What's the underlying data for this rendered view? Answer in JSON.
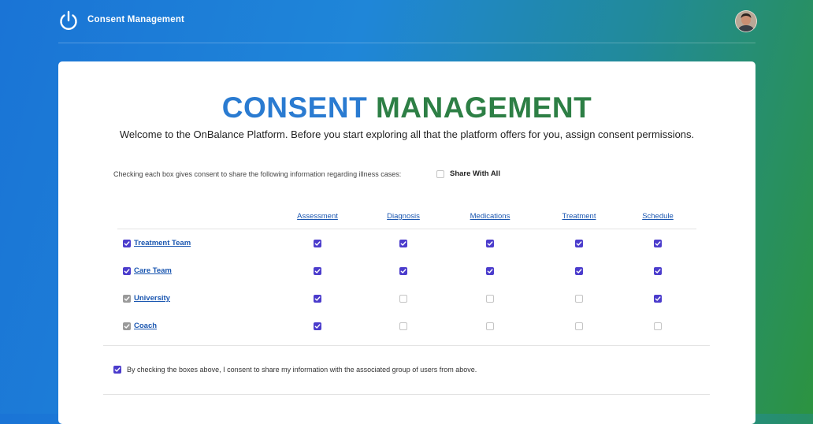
{
  "header": {
    "app_title": "Consent Management",
    "icon": "power-icon",
    "avatar": "user-avatar"
  },
  "main": {
    "title_part1": "CONSENT",
    "title_part2": "MANAGEMENT",
    "welcome": "Welcome to the OnBalance Platform. Before you start exploring all that the platform offers for you, assign consent permissions.",
    "hint": "Checking each box gives consent to share the following information regarding illness cases:",
    "share_all_label": "Share With All",
    "share_all_checked": false,
    "columns": [
      "Assessment",
      "Diagnosis",
      "Medications",
      "Treatment",
      "Schedule"
    ],
    "rows": [
      {
        "label": "Treatment Team",
        "checked": true,
        "disabled_style": false,
        "cells": [
          true,
          true,
          true,
          true,
          true
        ]
      },
      {
        "label": "Care Team",
        "checked": true,
        "disabled_style": false,
        "cells": [
          true,
          true,
          true,
          true,
          true
        ]
      },
      {
        "label": "University",
        "checked": true,
        "disabled_style": true,
        "cells": [
          true,
          false,
          false,
          false,
          true
        ]
      },
      {
        "label": "Coach",
        "checked": true,
        "disabled_style": true,
        "cells": [
          true,
          false,
          false,
          false,
          false
        ]
      }
    ],
    "agree_text": "By checking the boxes above, I consent to share my information with the associated group of users from above.",
    "agree_checked": true
  },
  "colors": {
    "accent": "#4b3ccc",
    "title_blue": "#2a7bd1",
    "title_green": "#2d7f45",
    "link": "#1a56b0"
  }
}
